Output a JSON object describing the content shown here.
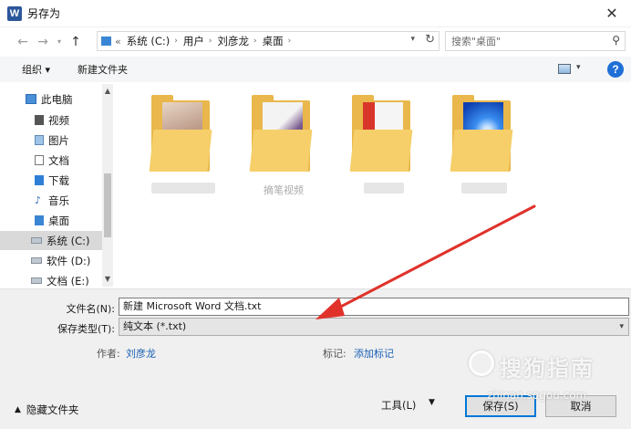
{
  "window": {
    "app_icon_letter": "W",
    "title": "另存为",
    "close_glyph": "✕"
  },
  "address_bar": {
    "prefix_glyph": "«",
    "breadcrumbs": [
      "系统 (C:)",
      "用户",
      "刘彦龙",
      "桌面"
    ],
    "search_placeholder": "搜索\"桌面\""
  },
  "toolbar": {
    "organize_label": "组织 ▾",
    "new_folder_label": "新建文件夹",
    "help_glyph": "?"
  },
  "sidebar": {
    "items": [
      {
        "label": "此电脑",
        "icon": "computer-icon"
      },
      {
        "label": "视频",
        "icon": "video-folder-icon"
      },
      {
        "label": "图片",
        "icon": "picture-folder-icon"
      },
      {
        "label": "文档",
        "icon": "document-folder-icon"
      },
      {
        "label": "下载",
        "icon": "download-folder-icon"
      },
      {
        "label": "音乐",
        "icon": "music-folder-icon"
      },
      {
        "label": "桌面",
        "icon": "desktop-folder-icon"
      },
      {
        "label": "系统 (C:)",
        "icon": "drive-icon",
        "selected": true
      },
      {
        "label": "软件 (D:)",
        "icon": "drive-icon"
      },
      {
        "label": "文档 (E:)",
        "icon": "drive-icon"
      }
    ]
  },
  "content": {
    "folders": [
      {
        "name": "",
        "icon": "folder-icon"
      },
      {
        "name": "摘笔视频",
        "icon": "folder-icon"
      },
      {
        "name": "",
        "icon": "folder-icon"
      },
      {
        "name": "",
        "icon": "folder-icon"
      }
    ]
  },
  "form": {
    "filename_label": "文件名(N):",
    "filename_value": "新建 Microsoft Word 文档.txt",
    "filetype_label": "保存类型(T):",
    "filetype_value": "纯文本 (*.txt)",
    "author_label": "作者:",
    "author_value": "刘彦龙",
    "tags_label": "标记:",
    "tags_value": "添加标记"
  },
  "footer": {
    "hide_folders_label": "隐藏文件夹",
    "tools_label": "工具(L)",
    "save_label": "保存(S)",
    "cancel_label": "取消"
  },
  "watermark": {
    "brand": "搜狗指南",
    "url": "zhinan.sogou.com"
  },
  "colors": {
    "accent": "#0078d7",
    "link": "#1a5fb4",
    "annotation_arrow": "#e0322b",
    "folder": "#f6cf6a"
  }
}
